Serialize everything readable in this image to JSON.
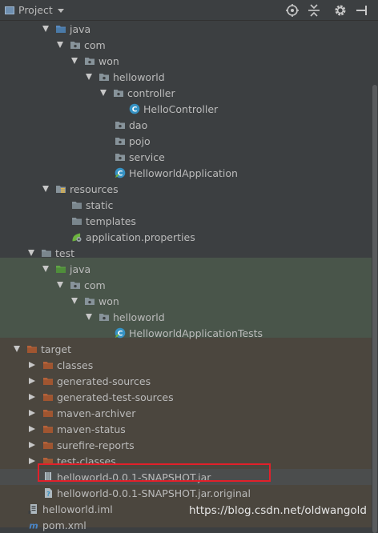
{
  "header": {
    "title": "Project",
    "icons": [
      "project-icon",
      "dropdown-icon",
      "locate-icon",
      "collapse-all-icon",
      "settings-icon",
      "hide-icon"
    ]
  },
  "colors": {
    "background": "#3c3f41",
    "test_band": "#49554a",
    "target_band": "#4b463e",
    "selected_row": "#4b4d4d",
    "highlight_box": "#e2202a",
    "folder": "#87939a",
    "source_folder": "#5a8bbf",
    "test_folder": "#62a647",
    "excluded_folder": "#b5623a",
    "class_icon": "#3592c4",
    "spring_icon": "#6db33f"
  },
  "tree": [
    {
      "depth": 3,
      "arrow": "down",
      "icon": "source-folder-icon",
      "label": "java"
    },
    {
      "depth": 4,
      "arrow": "down",
      "icon": "package-icon",
      "label": "com"
    },
    {
      "depth": 5,
      "arrow": "down",
      "icon": "package-icon",
      "label": "won"
    },
    {
      "depth": 6,
      "arrow": "down",
      "icon": "package-icon",
      "label": "helloworld"
    },
    {
      "depth": 7,
      "arrow": "down",
      "icon": "package-icon",
      "label": "controller"
    },
    {
      "depth": 8,
      "arrow": "none",
      "icon": "java-class-icon",
      "label": "HelloController"
    },
    {
      "depth": 7,
      "arrow": "none",
      "icon": "package-icon",
      "label": "dao"
    },
    {
      "depth": 7,
      "arrow": "none",
      "icon": "package-icon",
      "label": "pojo"
    },
    {
      "depth": 7,
      "arrow": "none",
      "icon": "package-icon",
      "label": "service"
    },
    {
      "depth": 7,
      "arrow": "none",
      "icon": "spring-boot-class-icon",
      "label": "HelloworldApplication"
    },
    {
      "depth": 3,
      "arrow": "down",
      "icon": "resources-folder-icon",
      "label": "resources"
    },
    {
      "depth": 4,
      "arrow": "none",
      "icon": "folder-icon",
      "label": "static"
    },
    {
      "depth": 4,
      "arrow": "none",
      "icon": "folder-icon",
      "label": "templates"
    },
    {
      "depth": 4,
      "arrow": "none",
      "icon": "spring-properties-icon",
      "label": "application.properties"
    },
    {
      "depth": 2,
      "arrow": "down",
      "icon": "folder-icon",
      "label": "test"
    },
    {
      "depth": 3,
      "arrow": "down",
      "icon": "test-source-folder-icon",
      "label": "java"
    },
    {
      "depth": 4,
      "arrow": "down",
      "icon": "package-icon",
      "label": "com"
    },
    {
      "depth": 5,
      "arrow": "down",
      "icon": "package-icon",
      "label": "won"
    },
    {
      "depth": 6,
      "arrow": "down",
      "icon": "package-icon",
      "label": "helloworld"
    },
    {
      "depth": 7,
      "arrow": "none",
      "icon": "spring-boot-class-icon",
      "label": "HelloworldApplicationTests"
    },
    {
      "depth": 1,
      "arrow": "down",
      "icon": "excluded-folder-icon",
      "label": "target"
    },
    {
      "depth": 2,
      "arrow": "right",
      "icon": "excluded-folder-icon",
      "label": "classes"
    },
    {
      "depth": 2,
      "arrow": "right",
      "icon": "excluded-folder-icon",
      "label": "generated-sources"
    },
    {
      "depth": 2,
      "arrow": "right",
      "icon": "excluded-folder-icon",
      "label": "generated-test-sources"
    },
    {
      "depth": 2,
      "arrow": "right",
      "icon": "excluded-folder-icon",
      "label": "maven-archiver"
    },
    {
      "depth": 2,
      "arrow": "right",
      "icon": "excluded-folder-icon",
      "label": "maven-status"
    },
    {
      "depth": 2,
      "arrow": "right",
      "icon": "excluded-folder-icon",
      "label": "surefire-reports"
    },
    {
      "depth": 2,
      "arrow": "right",
      "icon": "excluded-folder-icon",
      "label": "test-classes"
    },
    {
      "depth": 2,
      "arrow": "none",
      "icon": "jar-icon",
      "label": "helloworld-0.0.1-SNAPSHOT.jar",
      "selected": true
    },
    {
      "depth": 2,
      "arrow": "none",
      "icon": "file-unknown-icon",
      "label": "helloworld-0.0.1-SNAPSHOT.jar.original"
    },
    {
      "depth": 1,
      "arrow": "none",
      "icon": "iml-module-icon",
      "label": "helloworld.iml"
    },
    {
      "depth": 1,
      "arrow": "none",
      "icon": "maven-icon",
      "label": "pom.xml"
    }
  ],
  "watermark": "https://blog.csdn.net/oldwangold"
}
